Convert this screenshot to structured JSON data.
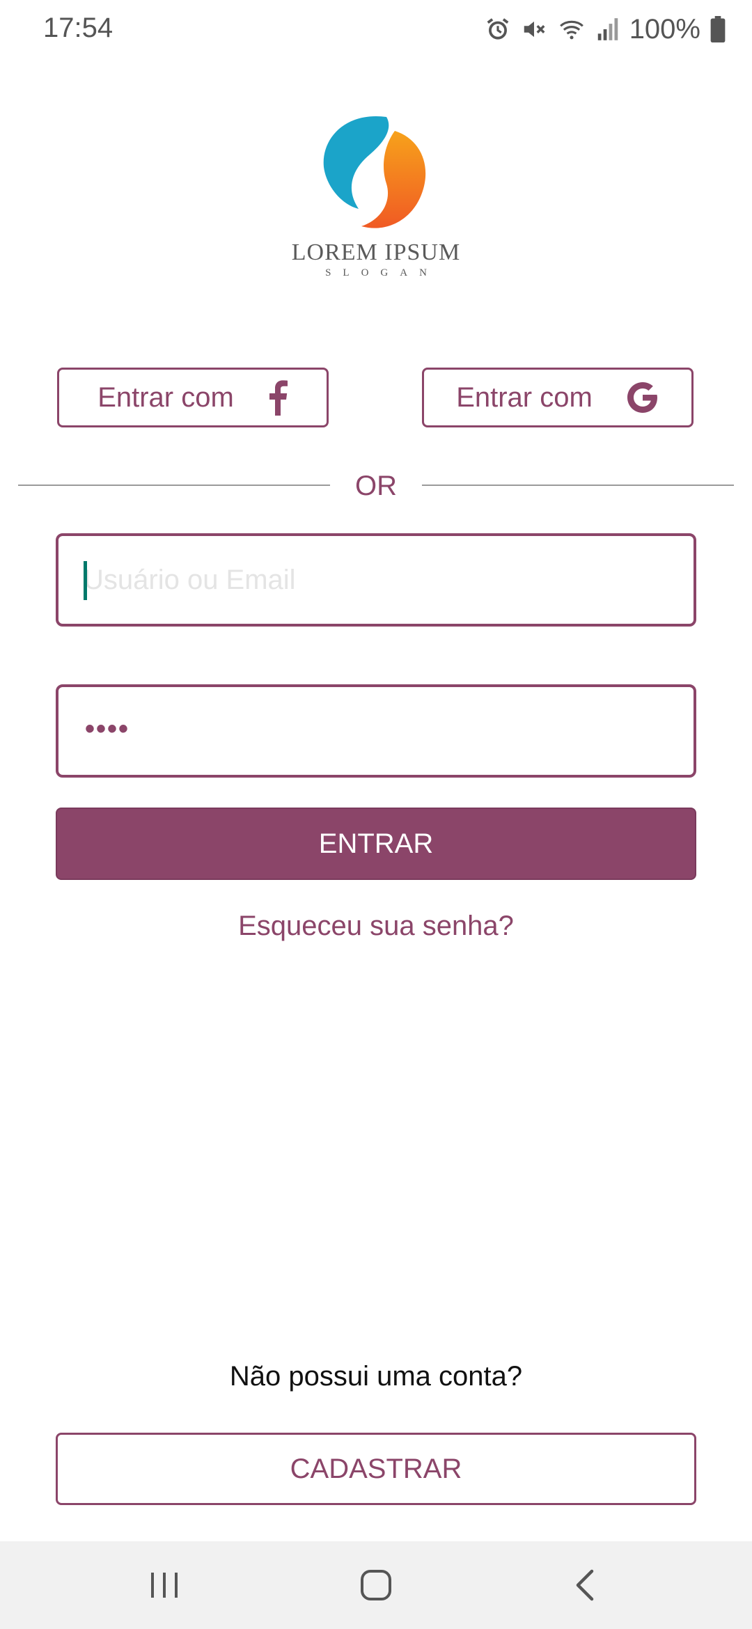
{
  "status_bar": {
    "time": "17:54",
    "battery": "100%",
    "icons": [
      "alarm-icon",
      "mute-icon",
      "wifi-icon",
      "signal-icon",
      "battery-icon"
    ]
  },
  "logo": {
    "name": "LOREM IPSUM",
    "slogan": "SLOGAN",
    "colors": {
      "blue": "#1ba4c9",
      "orange": "#f58220"
    }
  },
  "social": {
    "facebook": {
      "label": "Entrar com",
      "icon": "facebook-icon"
    },
    "google": {
      "label": "Entrar com",
      "icon": "google-icon"
    }
  },
  "divider": {
    "label": "OR"
  },
  "form": {
    "username": {
      "placeholder": "Usuário ou Email",
      "value": ""
    },
    "password": {
      "masked_value": "••••"
    },
    "submit_label": "ENTRAR",
    "forgot_label": "Esqueceu sua senha?"
  },
  "signup": {
    "prompt": "Não possui uma conta?",
    "button_label": "CADASTRAR"
  },
  "nav_bar": {
    "icons": [
      "recents-icon",
      "home-icon",
      "back-icon"
    ]
  },
  "theme": {
    "accent": "#8b4569",
    "cursor": "#00796b",
    "nav_background": "#f1f1f1"
  }
}
